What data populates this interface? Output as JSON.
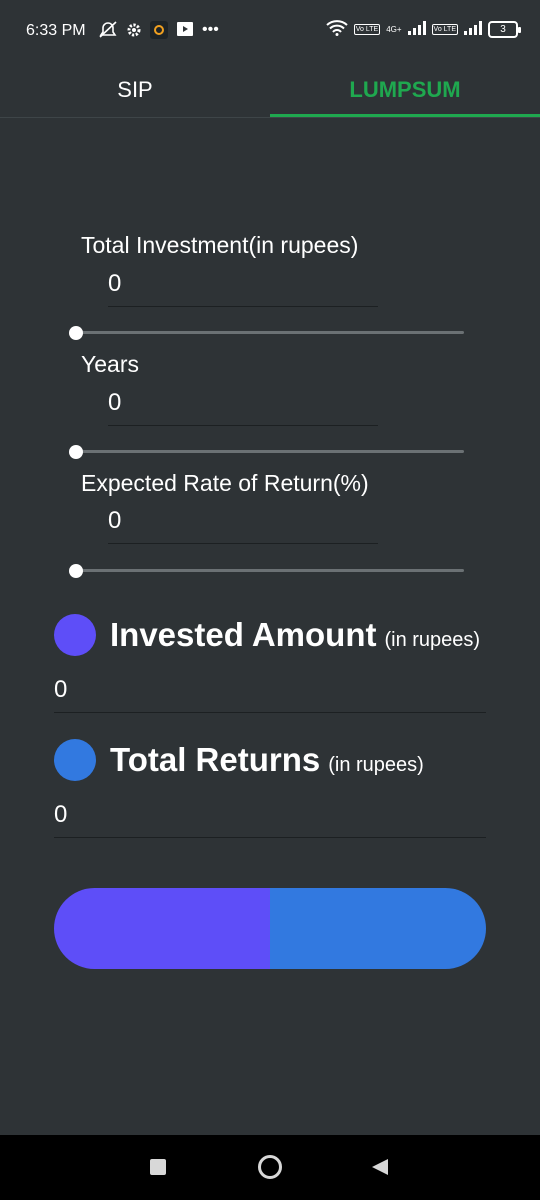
{
  "status_bar": {
    "time": "6:33 PM",
    "icons": [
      "mute-icon",
      "settings-icon",
      "app-notification-icon",
      "screen-icon",
      "more-icon"
    ],
    "network": "4G+",
    "lte_label": "Vo LTE",
    "battery": "3"
  },
  "tabs": [
    {
      "label": "SIP",
      "selected": false
    },
    {
      "label": "LUMPSUM",
      "selected": true
    }
  ],
  "inputs": [
    {
      "label": "Total Investment(in rupees)",
      "value": "0",
      "slider_value": 0
    },
    {
      "label": "Years",
      "value": "0",
      "slider_value": 0
    },
    {
      "label": "Expected Rate of Return(%)",
      "value": "0",
      "slider_value": 0
    }
  ],
  "results": {
    "invested": {
      "title": "Invested Amount",
      "unit": "(in rupees)",
      "value": "0"
    },
    "returns": {
      "title": "Total Returns",
      "unit": "(in rupees)",
      "value": "0"
    }
  },
  "bar": {
    "invested_fraction": 0.5
  },
  "colors": {
    "background": "#2e3336",
    "accent_green": "#1fa84f",
    "invested": "#5e4ef8",
    "returns": "#3279e0"
  }
}
